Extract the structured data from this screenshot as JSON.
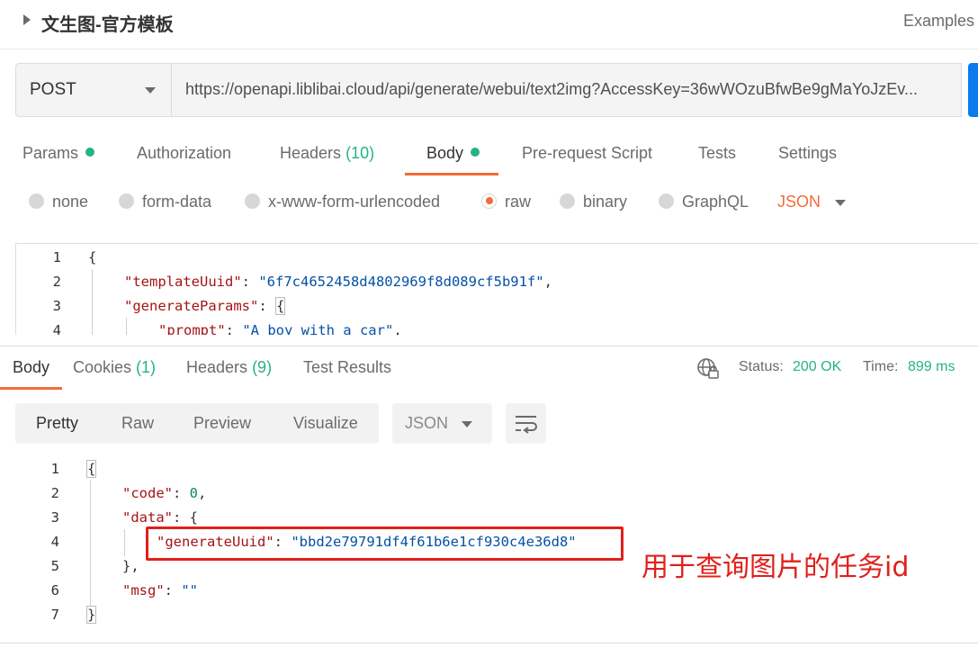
{
  "header": {
    "title": "文生图-官方模板",
    "examples_label": "Examples"
  },
  "request": {
    "method": "POST",
    "url": "https://openapi.liblibai.cloud/api/generate/webui/text2img?AccessKey=36wWOzuBfwBe9gMaYoJzEv..."
  },
  "request_tabs": {
    "params": "Params",
    "authorization": "Authorization",
    "headers": "Headers",
    "headers_count": "(10)",
    "body": "Body",
    "prerequest": "Pre-request Script",
    "tests": "Tests",
    "settings": "Settings"
  },
  "body_types": {
    "none": "none",
    "form_data": "form-data",
    "urlencoded": "x-www-form-urlencoded",
    "raw": "raw",
    "binary": "binary",
    "graphql": "GraphQL",
    "selected_language": "JSON"
  },
  "request_body": {
    "line_numbers": [
      "1",
      "2",
      "3",
      "4"
    ],
    "open_brace": "{",
    "template_key": "\"templateUuid\"",
    "template_value": "\"6f7c4652458d4802969f8d089cf5b91f\"",
    "params_key": "\"generateParams\"",
    "params_open": "{",
    "prompt_key": "\"prompt\"",
    "prompt_value": "\"A boy with a car\""
  },
  "response_tabs": {
    "body": "Body",
    "cookies": "Cookies",
    "cookies_count": "(1)",
    "headers": "Headers",
    "headers_count": "(9)",
    "test_results": "Test Results"
  },
  "response_status": {
    "status_label": "Status:",
    "status_value": "200 OK",
    "time_label": "Time:",
    "time_value": "899 ms"
  },
  "view_modes": {
    "pretty": "Pretty",
    "raw": "Raw",
    "preview": "Preview",
    "visualize": "Visualize",
    "format": "JSON"
  },
  "response_body": {
    "line_numbers": [
      "1",
      "2",
      "3",
      "4",
      "5",
      "6",
      "7"
    ],
    "open_brace": "{",
    "code_key": "\"code\"",
    "code_value": "0",
    "data_key": "\"data\"",
    "data_open": "{",
    "uuid_key": "\"generateUuid\"",
    "uuid_value": "\"bbd2e79791df4f61b6e1cf930c4e36d8\"",
    "data_close": "},",
    "msg_key": "\"msg\"",
    "msg_value": "\"\"",
    "close_brace": "}"
  },
  "annotation": {
    "text": "用于查询图片的任务id",
    "color": "#e0201b"
  },
  "colors": {
    "accent": "#f26b3a",
    "success": "#26b47f",
    "send_button": "#097bed"
  }
}
